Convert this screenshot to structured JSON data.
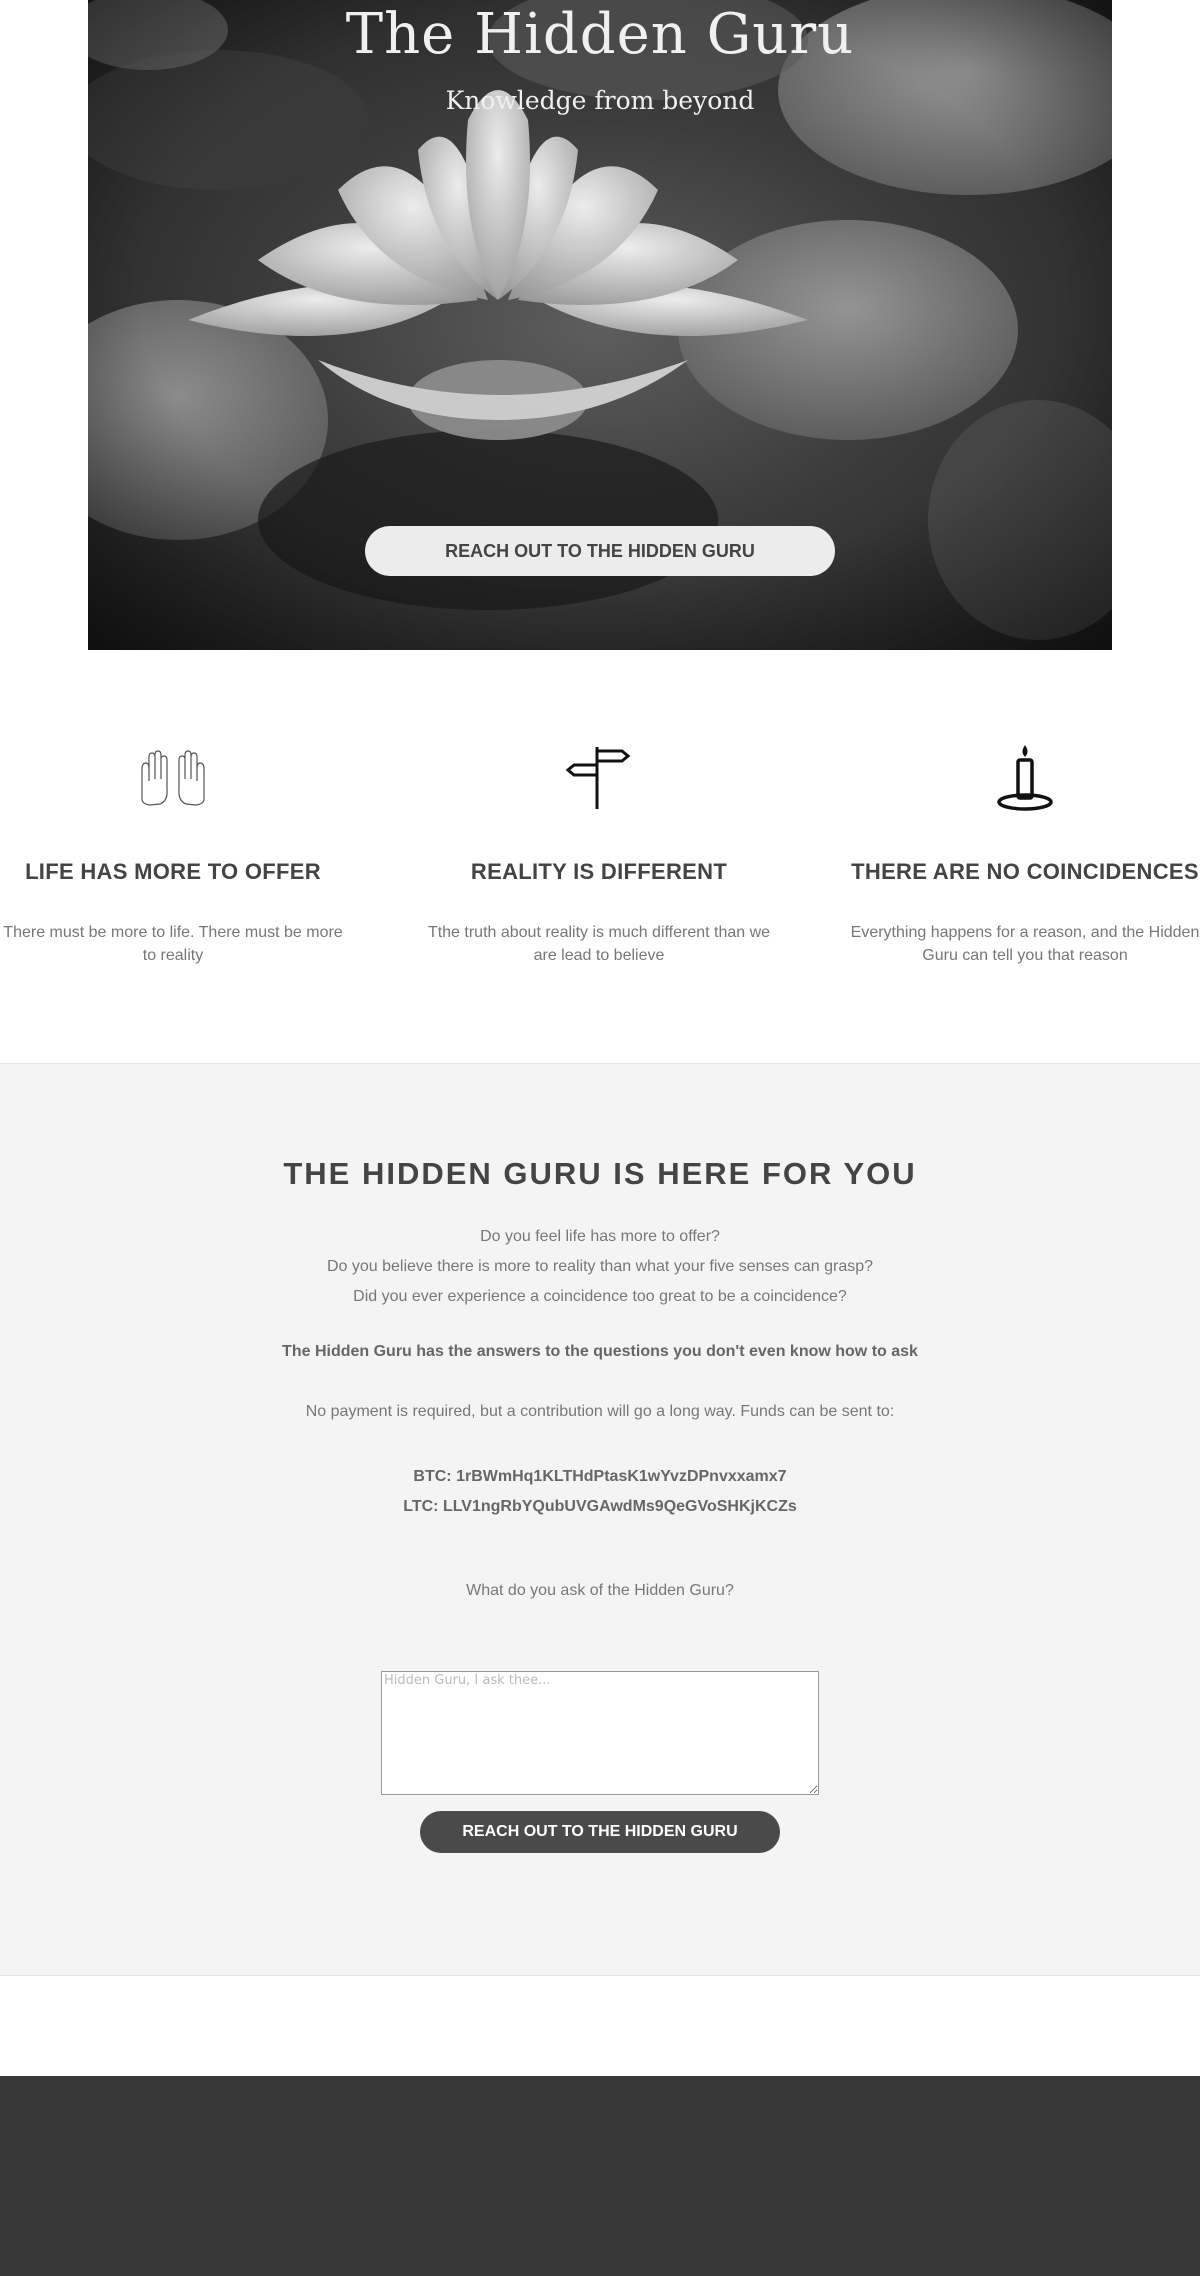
{
  "hero": {
    "title": "The Hidden Guru",
    "subtitle": "Knowledge from beyond",
    "button_label": "REACH OUT TO THE HIDDEN GURU"
  },
  "features": [
    {
      "icon": "praying-hands-icon",
      "title": "LIFE HAS MORE TO OFFER",
      "text": "There must be more to life. There must be more to reality"
    },
    {
      "icon": "signpost-icon",
      "title": "REALITY IS DIFFERENT",
      "text": "Tthe truth about reality is much different than we are lead to believe"
    },
    {
      "icon": "candle-icon",
      "title": "THERE ARE NO COINCIDENCES",
      "text": "Everything happens for a reason, and the Hidden Guru can tell you that reason"
    }
  ],
  "message": {
    "heading": "THE HIDDEN GURU IS HERE FOR YOU",
    "questions": [
      "Do you feel life has more to offer?",
      "Do you believe there is more to reality than what your five senses can grasp?",
      "Did you ever experience a coincidence too great to be a coincidence?"
    ],
    "bold_line": "The Hidden Guru has the answers to the questions you don't even know how to ask",
    "payment_line": "No payment is required, but a contribution will go a long way. Funds can be sent to:",
    "btc": "BTC: 1rBWmHq1KLTHdPtasK1wYvzDPnvxxamx7",
    "ltc": "LTC: LLV1ngRbYQubUVGAwdMs9QeGVoSHKjKCZs",
    "ask_label": "What do you ask of the Hidden Guru?",
    "textarea_placeholder": "Hidden Guru, I ask thee...",
    "textarea_value": "",
    "submit_label": "REACH OUT TO THE HIDDEN GURU"
  },
  "colors": {
    "heading": "#444444",
    "body_text": "#777777",
    "section_bg": "#f4f4f4",
    "footer_bg": "#383838",
    "submit_bg": "#4a4a4a",
    "hero_button_bg": "#ececec"
  }
}
